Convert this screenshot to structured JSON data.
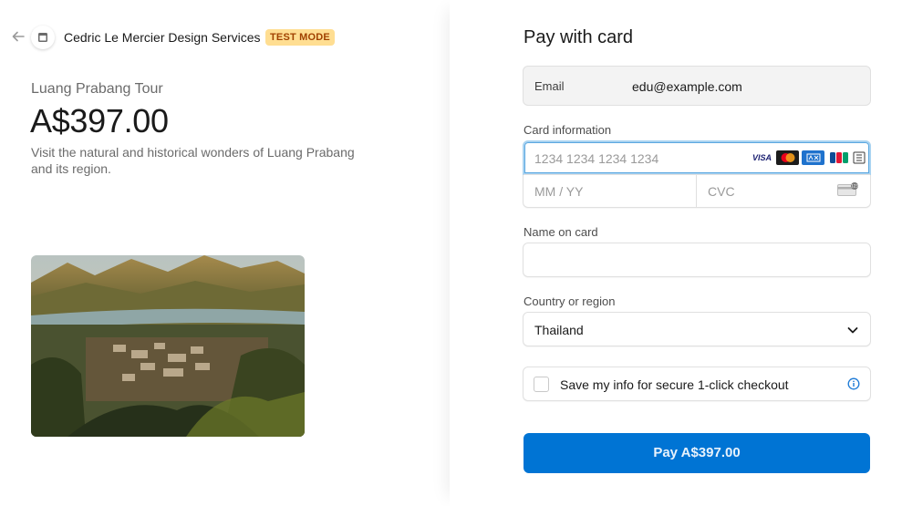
{
  "header": {
    "merchant_name": "Cedric Le Mercier Design Services",
    "test_badge": "TEST MODE"
  },
  "product": {
    "name": "Luang Prabang Tour",
    "price": "A$397.00",
    "description": "Visit the natural and historical wonders of Luang Prabang and its region."
  },
  "form": {
    "title": "Pay with card",
    "email": {
      "label": "Email",
      "value": "edu@example.com"
    },
    "card": {
      "label": "Card information",
      "number_placeholder": "1234 1234 1234 1234",
      "expiry_placeholder": "MM / YY",
      "cvc_placeholder": "CVC",
      "brands": [
        "visa-icon",
        "mastercard-icon",
        "amex-icon",
        "jcb-icon",
        "unionpay-icon"
      ],
      "visa_text": "VISA"
    },
    "name_on_card": {
      "label": "Name on card",
      "value": ""
    },
    "country": {
      "label": "Country or region",
      "value": "Thailand"
    },
    "save_info": {
      "label": "Save my info for secure 1-click checkout",
      "checked": false
    },
    "pay_button": "Pay A$397.00"
  },
  "colors": {
    "primary": "#0074d4",
    "test_badge_bg": "#ffde92",
    "test_badge_text": "#a04100"
  }
}
